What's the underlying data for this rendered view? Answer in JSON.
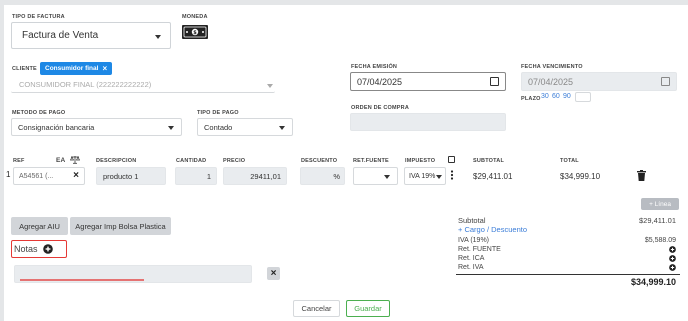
{
  "header": {
    "tipo_factura_label": "TIPO DE FACTURA",
    "tipo_factura_value": "Factura de Venta",
    "moneda_label": "MONEDA"
  },
  "cliente": {
    "label": "CLIENTE",
    "tag": "Consumidor final",
    "tag_close": "×",
    "value": "CONSUMIDOR FINAL (222222222222)"
  },
  "fechas": {
    "emision_label": "FECHA EMISIÓN",
    "emision_value": "07/04/2025",
    "vencimiento_label": "FECHA VENCIMIENTO",
    "vencimiento_value": "07/04/2025",
    "plazo_label": "PLAZO",
    "plazo_options": [
      "30",
      "60",
      "90"
    ]
  },
  "pago": {
    "metodo_label": "METODO DE PAGO",
    "metodo_value": "Consignación bancaria",
    "tipo_label": "TIPO DE PAGO",
    "tipo_value": "Contado",
    "orden_label": "ORDEN DE COMPRA"
  },
  "items_table": {
    "headers": {
      "ref": "REF",
      "ea": "EA",
      "descripcion": "DESCRIPCION",
      "cantidad": "CANTIDAD",
      "precio": "PRECIO",
      "descuento": "DESCUENTO",
      "ret_fuente": "RET.FUENTE",
      "impuesto": "IMPUESTO",
      "subtotal": "SUBTOTAL",
      "total": "TOTAL"
    },
    "rows": [
      {
        "index": "1",
        "ref": "A54561 (...",
        "remove": "×",
        "descripcion": "producto 1",
        "cantidad": "1",
        "precio": "29411,01",
        "descuento_unit": "%",
        "impuesto": "IVA 19%",
        "subtotal": "$29,411.01",
        "total": "$34,999.10"
      }
    ]
  },
  "actions": {
    "add_line": "+ Línea",
    "agregar_aiu": "Agregar AIU",
    "agregar_bolsa": "Agregar Imp Bolsa Plastica",
    "notas": "Notas",
    "cancelar": "Cancelar",
    "guardar": "Guardar"
  },
  "totals": {
    "subtotal_label": "Subtotal",
    "subtotal_value": "$29,411.01",
    "cargo_label": "+ Cargo / Descuento",
    "iva_label": "IVA (19%)",
    "iva_value": "$5,588.09",
    "ret_fuente_label": "Ret. FUENTE",
    "ret_ica_label": "Ret. ICA",
    "ret_iva_label": "Ret. IVA",
    "grand_total": "$34,999.10"
  },
  "colors": {
    "accent_blue": "#1e88e5",
    "link_blue": "#3b7dd8",
    "highlight_red": "#e53935",
    "guardar_green": "#4caf50"
  }
}
